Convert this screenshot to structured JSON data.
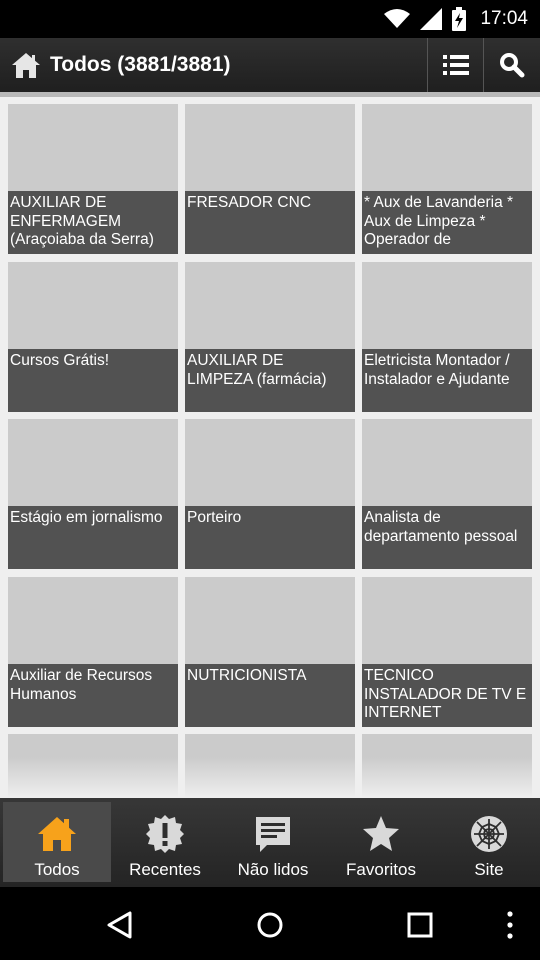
{
  "status_bar": {
    "time": "17:04"
  },
  "action_bar": {
    "title": "Todos (3881/3881)"
  },
  "cards": [
    {
      "caption": "AUXILIAR DE ENFERMAGEM (Araçoiaba da Serra)"
    },
    {
      "caption": "FRESADOR CNC"
    },
    {
      "caption": "* Aux de Lavanderia * Aux de Limpeza * Operador de"
    },
    {
      "caption": "Cursos Grátis!"
    },
    {
      "caption": "AUXILIAR DE LIMPEZA (farmácia)"
    },
    {
      "caption": "Eletricista Montador / Instalador e Ajudante"
    },
    {
      "caption": "Estágio em jornalismo"
    },
    {
      "caption": "Porteiro"
    },
    {
      "caption": "Analista de departamento pessoal"
    },
    {
      "caption": "Auxiliar de Recursos Humanos"
    },
    {
      "caption": "NUTRICIONISTA"
    },
    {
      "caption": "TECNICO INSTALADOR DE TV E INTERNET"
    }
  ],
  "bottom_nav": [
    {
      "label": "Todos",
      "icon": "home-icon",
      "active": true
    },
    {
      "label": "Recentes",
      "icon": "alert-badge-icon",
      "active": false
    },
    {
      "label": "Não lidos",
      "icon": "unread-list-icon",
      "active": false
    },
    {
      "label": "Favoritos",
      "icon": "star-icon",
      "active": false
    },
    {
      "label": "Site",
      "icon": "web-icon",
      "active": false
    }
  ],
  "colors": {
    "accent": "#f7a21b",
    "caption_bg": "#525252",
    "thumb_bg": "#cbcbcb"
  }
}
